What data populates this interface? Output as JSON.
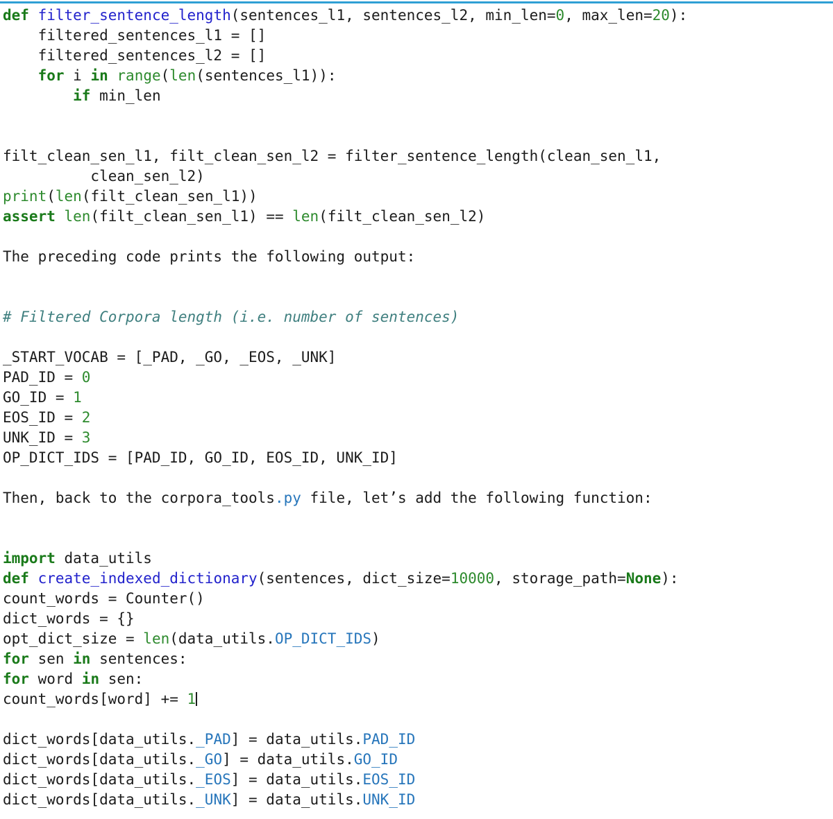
{
  "theme": {
    "background": "#ffffff",
    "text": "#1c1c1c",
    "rule": "#2e9fd4",
    "keyword": "#1a7a1a",
    "function_name": "#2222cc",
    "builtin": "#2d8a2d",
    "number": "#2d8a2d",
    "attribute": "#2776bb",
    "comment": "#3f7f7f"
  },
  "lines": {
    "l01_def": "def ",
    "l01_name": "filter_sentence_length",
    "l01_args_a": "(sentences_l1, sentences_l2, min_len=",
    "l01_num0": "0",
    "l01_args_b": ", max_len=",
    "l01_num20": "20",
    "l01_end": "):",
    "l02": "    filtered_sentences_l1 = []",
    "l03": "    filtered_sentences_l2 = []",
    "l04_ind": "    ",
    "l04_for": "for",
    "l04_i": " i ",
    "l04_in": "in",
    "l04_sp": " ",
    "l04_range": "range",
    "l04_p1": "(",
    "l04_len": "len",
    "l04_rest": "(sentences_l1)):",
    "l05_ind": "        ",
    "l05_if": "if",
    "l05_rest": " min_len",
    "l06_blank": "",
    "l07_blank": "",
    "l08_a": "filt_clean_sen_l1, filt_clean_sen_l2 = ",
    "l08_fn": "filter_sentence_length",
    "l08_b": "(clean_sen_l1,",
    "l09": "          clean_sen_l2)",
    "l10_print": "print",
    "l10_p1": "(",
    "l10_len": "len",
    "l10_rest": "(filt_clean_sen_l1))",
    "l11_assert": "assert",
    "l11_sp": " ",
    "l11_len1": "len",
    "l11_mid": "(filt_clean_sen_l1) == ",
    "l11_len2": "len",
    "l11_end": "(filt_clean_sen_l2)",
    "l12_blank": "",
    "l13": "The preceding code prints the following output:",
    "l14_blank": "",
    "l15_blank": "",
    "l16_comment": "# Filtered Corpora length (i.e. number of sentences)",
    "l17_blank": "",
    "l18": "_START_VOCAB = [_PAD, _GO, _EOS, _UNK]",
    "l19_a": "PAD_ID = ",
    "l19_n": "0",
    "l20_a": "GO_ID = ",
    "l20_n": "1",
    "l21_a": "EOS_ID = ",
    "l21_n": "2",
    "l22_a": "UNK_ID = ",
    "l22_n": "3",
    "l23": "OP_DICT_IDS = [PAD_ID, GO_ID, EOS_ID, UNK_ID]",
    "l24_blank": "",
    "l25_a": "Then, back to the corpora_tools",
    "l25_py": ".py",
    "l25_b": " file, let’s add the following function:",
    "l26_blank": "",
    "l27_blank": "",
    "l28_import": "import",
    "l28_rest": " data_utils",
    "l29_def": "def ",
    "l29_name": "create_indexed_dictionary",
    "l29_a": "(sentences, dict_size=",
    "l29_num": "10000",
    "l29_b": ", storage_path=",
    "l29_none": "None",
    "l29_end": "):",
    "l30": "count_words = Counter()",
    "l31": "dict_words = {}",
    "l32_a": "opt_dict_size = ",
    "l32_len": "len",
    "l32_b": "(data_utils.",
    "l32_attr": "OP_DICT_IDS",
    "l32_c": ")",
    "l33_for": "for",
    "l33_a": " sen ",
    "l33_in": "in",
    "l33_b": " sentences:",
    "l34_for": "for",
    "l34_a": " word ",
    "l34_in": "in",
    "l34_b": " sen:",
    "l35_a": "count_words[word] += ",
    "l35_n": "1",
    "l36_blank": "",
    "l37_a": "dict_words[data_utils.",
    "l37_attr1": "_PAD",
    "l37_b": "] = data_utils.",
    "l37_attr2": "PAD_ID",
    "l38_a": "dict_words[data_utils.",
    "l38_attr1": "_GO",
    "l38_b": "] = data_utils.",
    "l38_attr2": "GO_ID",
    "l39_a": "dict_words[data_utils.",
    "l39_attr1": "_EOS",
    "l39_b": "] = data_utils.",
    "l39_attr2": "EOS_ID",
    "l40_a": "dict_words[data_utils.",
    "l40_attr1": "_UNK",
    "l40_b": "] = data_utils.",
    "l40_attr2": "UNK_ID"
  }
}
